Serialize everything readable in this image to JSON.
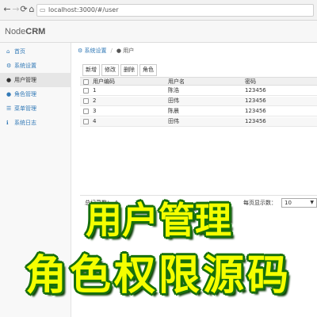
{
  "browser": {
    "url": "localhost:3000/#/user",
    "icons": [
      "back-icon",
      "forward-icon",
      "reload-icon",
      "home-icon",
      "page-icon"
    ]
  },
  "app": {
    "brand_prefix": "Node",
    "brand_bold": "CRM"
  },
  "sidebar": {
    "items": [
      {
        "label": "首页",
        "icon": "home-icon",
        "glyph": "⌂",
        "active": false
      },
      {
        "label": "系统设置",
        "icon": "cogs-icon",
        "glyph": "⚙",
        "active": false
      },
      {
        "label": "用户管理",
        "icon": "user-icon",
        "glyph": "●",
        "active": true
      },
      {
        "label": "角色管理",
        "icon": "users-icon",
        "glyph": "●",
        "active": false
      },
      {
        "label": "菜单管理",
        "icon": "list-icon",
        "glyph": "☰",
        "active": false
      },
      {
        "label": "系统日志",
        "icon": "info-icon",
        "glyph": "ℹ",
        "active": false
      }
    ]
  },
  "breadcrumb": {
    "parent": "系统设置",
    "current": "用户",
    "separator": "/"
  },
  "toolbar": {
    "add": "新增",
    "edit": "修改",
    "delete": "删除",
    "role": "角色"
  },
  "table": {
    "columns": [
      "用户编码",
      "用户名",
      "密码"
    ],
    "rows": [
      {
        "code": "1",
        "name": "陈浩",
        "password": "123456"
      },
      {
        "code": "2",
        "name": "田伟",
        "password": "123456"
      },
      {
        "code": "3",
        "name": "陈晨",
        "password": "123456"
      },
      {
        "code": "4",
        "name": "田伟",
        "password": "123456"
      }
    ]
  },
  "footer": {
    "total_label": "总记录数：",
    "total_value": "4",
    "page_size_label": "每页显示数：",
    "page_size_value": "10"
  },
  "overlay": {
    "line1": "用户管理",
    "line2": "角色权限源码"
  },
  "colors": {
    "link": "#337ab7",
    "overlay_text": "#f5ff00",
    "overlay_stroke": "#176f0c"
  }
}
